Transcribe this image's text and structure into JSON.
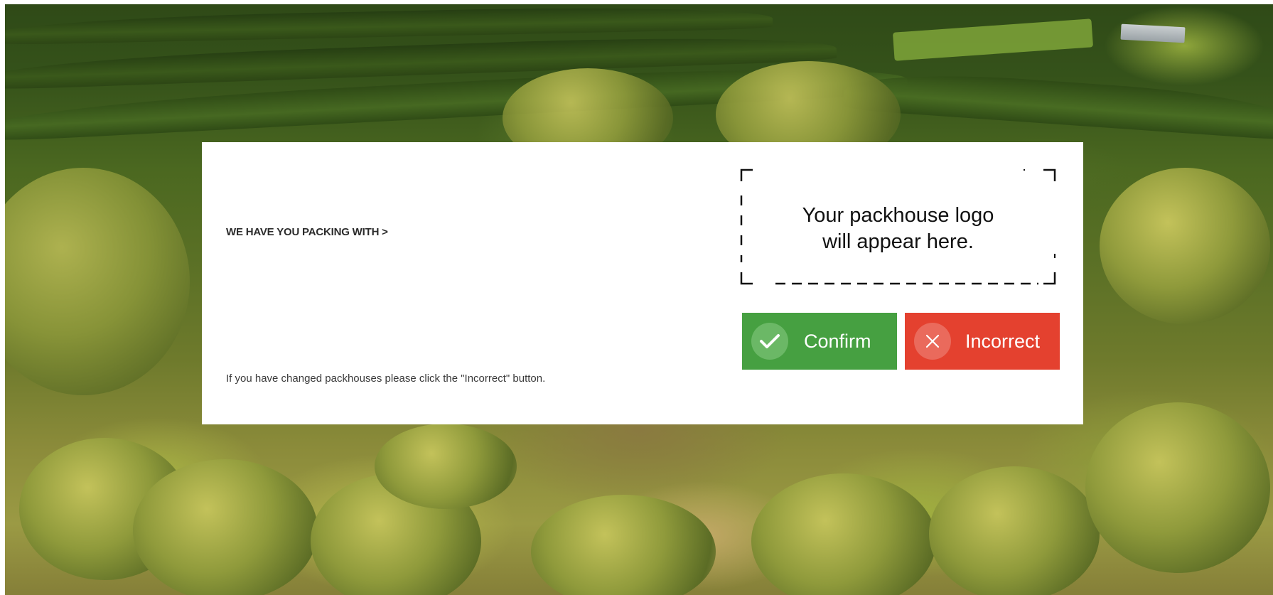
{
  "card": {
    "heading": "WE HAVE YOU PACKING WITH >",
    "note": "If you have changed packhouses please click the \"Incorrect\" button.",
    "logo_placeholder_line1": "Your packhouse logo",
    "logo_placeholder_line2": "will appear here."
  },
  "buttons": {
    "confirm": {
      "label": "Confirm",
      "icon": "check-icon",
      "color": "#46a041"
    },
    "incorrect": {
      "label": "Incorrect",
      "icon": "close-icon",
      "color": "#e4412f"
    }
  },
  "background": {
    "description_icon": "orchard-aerial-photo"
  }
}
